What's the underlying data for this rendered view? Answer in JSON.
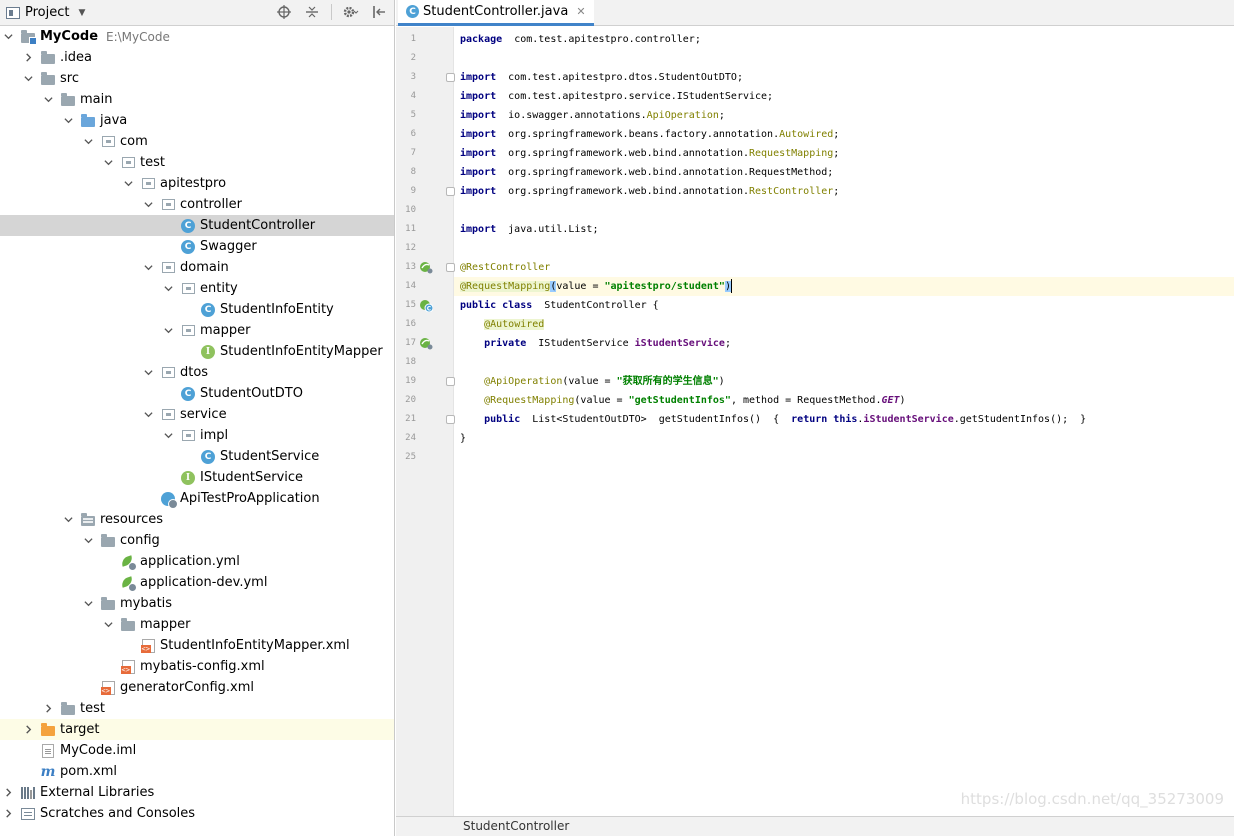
{
  "project_panel": {
    "title": "Project",
    "tree": [
      {
        "label": "MyCode",
        "sublabel": "E:\\MyCode",
        "bold": true,
        "icon": "module-folder-icon",
        "depth": 0,
        "arrow": "expanded"
      },
      {
        "label": ".idea",
        "icon": "folder-icon",
        "depth": 1,
        "arrow": "collapsed"
      },
      {
        "label": "src",
        "icon": "folder-icon",
        "depth": 1,
        "arrow": "expanded"
      },
      {
        "label": "main",
        "icon": "folder-icon",
        "depth": 2,
        "arrow": "expanded"
      },
      {
        "label": "java",
        "icon": "source-folder-icon",
        "depth": 3,
        "arrow": "expanded"
      },
      {
        "label": "com",
        "icon": "package-icon",
        "depth": 4,
        "arrow": "expanded"
      },
      {
        "label": "test",
        "icon": "package-icon",
        "depth": 5,
        "arrow": "expanded"
      },
      {
        "label": "apitestpro",
        "icon": "package-icon",
        "depth": 6,
        "arrow": "expanded"
      },
      {
        "label": "controller",
        "icon": "package-icon",
        "depth": 7,
        "arrow": "expanded"
      },
      {
        "label": "StudentController",
        "icon": "class-icon",
        "depth": 8,
        "arrow": "none",
        "selected": true
      },
      {
        "label": "Swagger",
        "icon": "class-icon",
        "depth": 8,
        "arrow": "none"
      },
      {
        "label": "domain",
        "icon": "package-icon",
        "depth": 7,
        "arrow": "expanded"
      },
      {
        "label": "entity",
        "icon": "package-icon",
        "depth": 8,
        "arrow": "expanded"
      },
      {
        "label": "StudentInfoEntity",
        "icon": "class-icon",
        "depth": 9,
        "arrow": "none"
      },
      {
        "label": "mapper",
        "icon": "package-icon",
        "depth": 8,
        "arrow": "expanded"
      },
      {
        "label": "StudentInfoEntityMapper",
        "icon": "interface-icon",
        "depth": 9,
        "arrow": "none"
      },
      {
        "label": "dtos",
        "icon": "package-icon",
        "depth": 7,
        "arrow": "expanded"
      },
      {
        "label": "StudentOutDTO",
        "icon": "class-icon",
        "depth": 8,
        "arrow": "none"
      },
      {
        "label": "service",
        "icon": "package-icon",
        "depth": 7,
        "arrow": "expanded"
      },
      {
        "label": "impl",
        "icon": "package-icon",
        "depth": 8,
        "arrow": "expanded"
      },
      {
        "label": "StudentService",
        "icon": "class-icon",
        "depth": 9,
        "arrow": "none"
      },
      {
        "label": "IStudentService",
        "icon": "interface-icon",
        "depth": 8,
        "arrow": "none"
      },
      {
        "label": "ApiTestProApplication",
        "icon": "spring-boot-class-icon",
        "depth": 7,
        "arrow": "none"
      },
      {
        "label": "resources",
        "icon": "resources-folder-icon",
        "depth": 3,
        "arrow": "expanded"
      },
      {
        "label": "config",
        "icon": "folder-icon",
        "depth": 4,
        "arrow": "expanded"
      },
      {
        "label": "application.yml",
        "icon": "yaml-file-icon",
        "depth": 5,
        "arrow": "none"
      },
      {
        "label": "application-dev.yml",
        "icon": "yaml-file-icon",
        "depth": 5,
        "arrow": "none"
      },
      {
        "label": "mybatis",
        "icon": "folder-icon",
        "depth": 4,
        "arrow": "expanded"
      },
      {
        "label": "mapper",
        "icon": "folder-icon",
        "depth": 5,
        "arrow": "expanded"
      },
      {
        "label": "StudentInfoEntityMapper.xml",
        "icon": "xml-file-icon",
        "depth": 6,
        "arrow": "none"
      },
      {
        "label": "mybatis-config.xml",
        "icon": "xml-file-icon",
        "depth": 5,
        "arrow": "none"
      },
      {
        "label": "generatorConfig.xml",
        "icon": "xml-file-icon",
        "depth": 4,
        "arrow": "none"
      },
      {
        "label": "test",
        "icon": "folder-icon",
        "depth": 2,
        "arrow": "collapsed"
      },
      {
        "label": "target",
        "icon": "excluded-folder-icon",
        "depth": 1,
        "arrow": "collapsed",
        "excluded": true
      },
      {
        "label": "MyCode.iml",
        "icon": "iml-file-icon",
        "depth": 1,
        "arrow": "none"
      },
      {
        "label": "pom.xml",
        "icon": "maven-file-icon",
        "depth": 1,
        "arrow": "none"
      },
      {
        "label": "External Libraries",
        "icon": "libraries-icon",
        "depth": 0,
        "arrow": "collapsed"
      },
      {
        "label": "Scratches and Consoles",
        "icon": "scratches-icon",
        "depth": 0,
        "arrow": "collapsed"
      }
    ]
  },
  "editor": {
    "tab_label": "StudentController.java",
    "breadcrumb": "StudentController",
    "current_line": 14,
    "lines": [
      {
        "n": "1",
        "tokens": [
          [
            "kw",
            "package"
          ],
          [
            "",
            "  com.test.apitestpro.controller;"
          ]
        ]
      },
      {
        "n": "2",
        "tokens": []
      },
      {
        "n": "3",
        "tokens": [
          [
            "kw",
            "import"
          ],
          [
            "",
            "  com.test.apitestpro.dtos.StudentOutDTO;"
          ]
        ],
        "fold": true
      },
      {
        "n": "4",
        "tokens": [
          [
            "kw",
            "import"
          ],
          [
            "",
            "  com.test.apitestpro.service.IStudentService;"
          ]
        ]
      },
      {
        "n": "5",
        "tokens": [
          [
            "kw",
            "import"
          ],
          [
            "",
            "  io.swagger.annotations."
          ],
          [
            "ann",
            "ApiOperation"
          ],
          [
            "",
            ";"
          ]
        ]
      },
      {
        "n": "6",
        "tokens": [
          [
            "kw",
            "import"
          ],
          [
            "",
            "  org.springframework.beans.factory.annotation."
          ],
          [
            "ann",
            "Autowired"
          ],
          [
            "",
            ";"
          ]
        ]
      },
      {
        "n": "7",
        "tokens": [
          [
            "kw",
            "import"
          ],
          [
            "",
            "  org.springframework.web.bind.annotation."
          ],
          [
            "ann",
            "RequestMapping"
          ],
          [
            "",
            ";"
          ]
        ]
      },
      {
        "n": "8",
        "tokens": [
          [
            "kw",
            "import"
          ],
          [
            "",
            "  org.springframework.web.bind.annotation.RequestMethod;"
          ]
        ]
      },
      {
        "n": "9",
        "tokens": [
          [
            "kw",
            "import"
          ],
          [
            "",
            "  org.springframework.web.bind.annotation."
          ],
          [
            "ann",
            "RestController"
          ],
          [
            "",
            ";"
          ]
        ],
        "fold": true
      },
      {
        "n": "10",
        "tokens": []
      },
      {
        "n": "11",
        "tokens": [
          [
            "kw",
            "import"
          ],
          [
            "",
            "  java.util.List;"
          ]
        ]
      },
      {
        "n": "12",
        "tokens": []
      },
      {
        "n": "13",
        "tokens": [
          [
            "ann",
            "@RestController"
          ]
        ],
        "mark": "bean",
        "fold": true
      },
      {
        "n": "14",
        "tokens": [
          [
            "ann-bg",
            "@RequestMapping"
          ],
          [
            "brace-hl",
            "("
          ],
          [
            "",
            "value = "
          ],
          [
            "str",
            "\"apitestpro/student\""
          ],
          [
            "brace-hl",
            ")"
          ]
        ]
      },
      {
        "n": "15",
        "tokens": [
          [
            "kw",
            "public class"
          ],
          [
            "",
            "  StudentController {"
          ]
        ],
        "mark": "class"
      },
      {
        "n": "16",
        "tokens": [
          [
            "",
            "    "
          ],
          [
            "ann-bg",
            "@Autowired"
          ]
        ]
      },
      {
        "n": "17",
        "tokens": [
          [
            "",
            "    "
          ],
          [
            "kw",
            "private"
          ],
          [
            "",
            "  IStudentService "
          ],
          [
            "fld",
            "iStudentService"
          ],
          [
            "",
            ";"
          ]
        ],
        "mark": "bean"
      },
      {
        "n": "18",
        "tokens": []
      },
      {
        "n": "19",
        "tokens": [
          [
            "",
            "    "
          ],
          [
            "ann",
            "@ApiOperation"
          ],
          [
            "",
            "(value = "
          ],
          [
            "str",
            "\"获取所有的学生信息\""
          ],
          [
            "",
            ")"
          ]
        ],
        "fold": true
      },
      {
        "n": "20",
        "tokens": [
          [
            "",
            "    "
          ],
          [
            "ann",
            "@RequestMapping"
          ],
          [
            "",
            "(value = "
          ],
          [
            "str",
            "\"getStudentInfos\""
          ],
          [
            "",
            ", method = RequestMethod."
          ],
          [
            "cnst",
            "GET"
          ],
          [
            "",
            ")"
          ]
        ]
      },
      {
        "n": "21",
        "tokens": [
          [
            "",
            "    "
          ],
          [
            "kw",
            "public"
          ],
          [
            "",
            "  List<StudentOutDTO>  getStudentInfos()  {  "
          ],
          [
            "kw",
            "return this"
          ],
          [
            "",
            "."
          ],
          [
            "fld",
            "iStudentService"
          ],
          [
            "",
            ".getStudentInfos();  }"
          ]
        ],
        "fold": true
      },
      {
        "n": "24",
        "tokens": [
          [
            "",
            "}"
          ]
        ]
      },
      {
        "n": "25",
        "tokens": []
      }
    ]
  },
  "watermark": "https://blog.csdn.net/qq_35273009"
}
